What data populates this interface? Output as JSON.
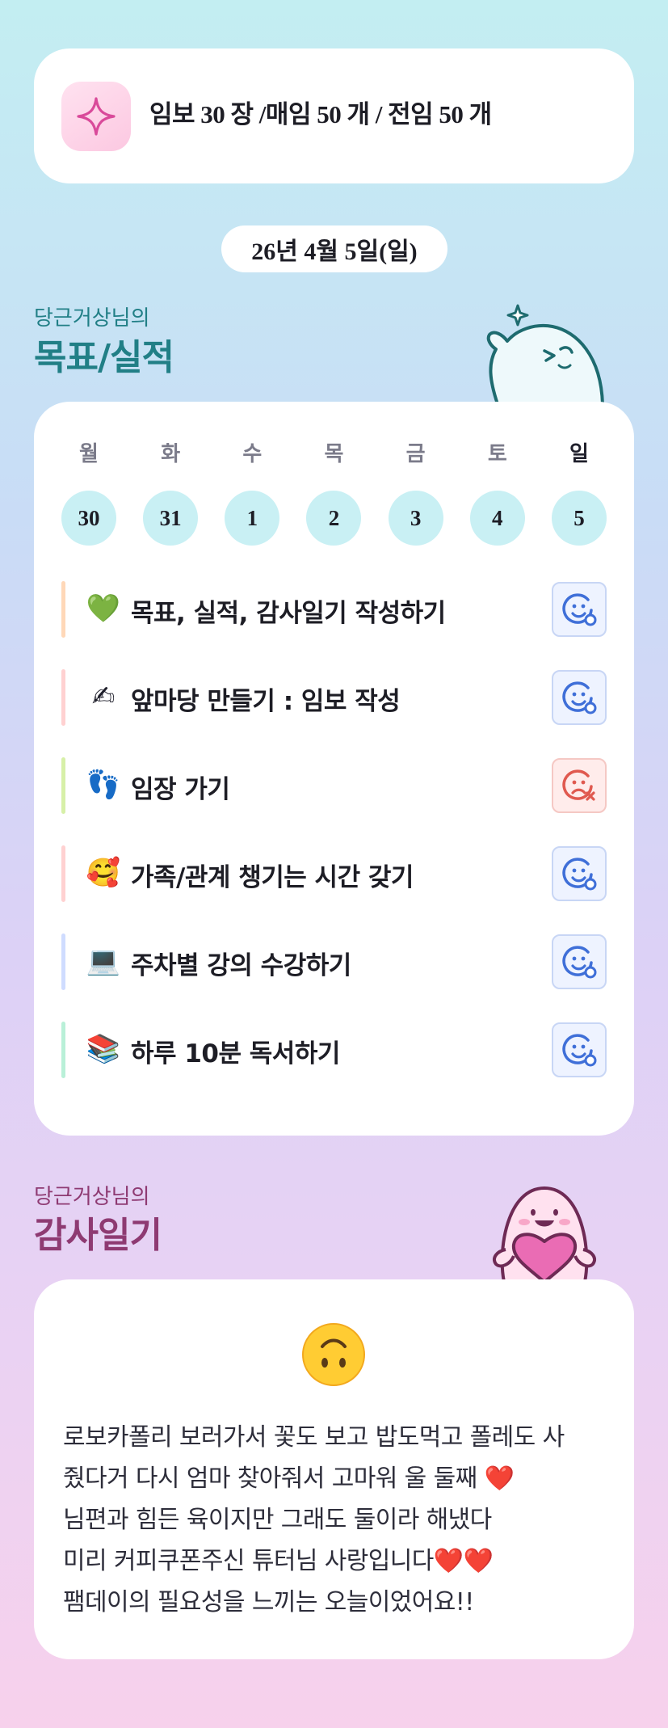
{
  "goal_banner": {
    "icon": "sparkle-icon",
    "text": "임보 30 장 /매임 50 개 / 전임 50 개"
  },
  "date": "26년 4월 5일(일)",
  "goals_section": {
    "owner": "당근거상님의",
    "title": "목표/실적"
  },
  "week": {
    "days": [
      {
        "label": "월",
        "date": "30"
      },
      {
        "label": "화",
        "date": "31"
      },
      {
        "label": "수",
        "date": "1"
      },
      {
        "label": "목",
        "date": "2"
      },
      {
        "label": "금",
        "date": "3"
      },
      {
        "label": "토",
        "date": "4"
      },
      {
        "label": "일",
        "date": "5"
      }
    ]
  },
  "tasks": [
    {
      "emoji": "💚",
      "label": "목표, 실적, 감사일기 작성하기",
      "status": "done",
      "bar_color": "#ffd8b8"
    },
    {
      "emoji": "✍",
      "label": "앞마당 만들기 : 임보 작성",
      "status": "done",
      "bar_color": "#ffd1d1"
    },
    {
      "emoji": "👣",
      "label": "임장 가기",
      "status": "missed",
      "bar_color": "#d7f0a8"
    },
    {
      "emoji": "🥰",
      "label": "가족/관계 챙기는 시간 갖기",
      "status": "done",
      "bar_color": "#ffd1d1"
    },
    {
      "emoji": "💻",
      "label": "주차별 강의 수강하기",
      "status": "done",
      "bar_color": "#cfdcff"
    },
    {
      "emoji": "📚",
      "label": "하루 10분 독서하기",
      "status": "done",
      "bar_color": "#b9f0d8"
    }
  ],
  "gratitude_section": {
    "owner": "당근거상님의",
    "title": "감사일기"
  },
  "gratitude": {
    "mood": "upside-down-face",
    "lines": [
      {
        "text": "로보카폴리 보러가서 꽃도 보고 밥도먹고 폴레도 사",
        "hearts": ""
      },
      {
        "text": "줬다거 다시 엄마 찾아줘서 고마워 울 둘째 ",
        "hearts": "❤️"
      },
      {
        "text": "님편과 힘든 육이지만 그래도 둘이라 해냈다",
        "hearts": ""
      },
      {
        "text": "미리 커피쿠폰주신 튜터님 사랑입니다",
        "hearts": "❤️❤️"
      },
      {
        "text": "팸데이의 필요성을 느끼는 오늘이었어요!!",
        "hearts": ""
      }
    ]
  },
  "colors": {
    "teal_title": "#217f86",
    "plum_title": "#8e3a72",
    "done_icon": "#3f6fd8",
    "missed_icon": "#e0594f",
    "date_circle": "#c9f0f4"
  }
}
